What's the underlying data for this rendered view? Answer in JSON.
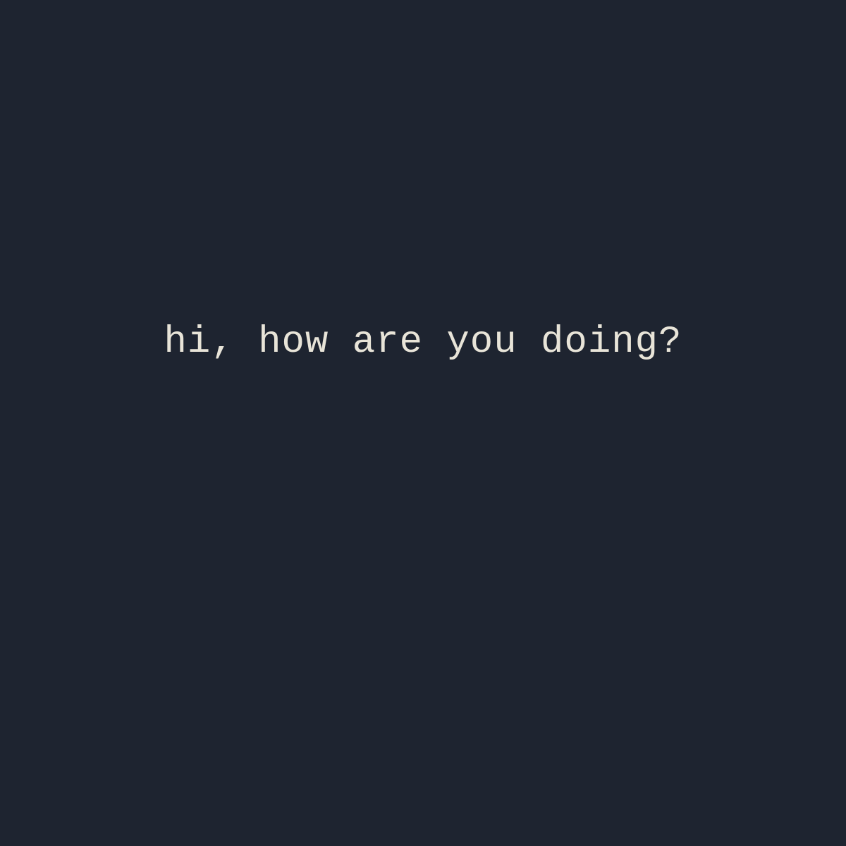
{
  "content": {
    "message": "hi, how are you doing?"
  },
  "colors": {
    "background": "#1e2430",
    "text": "#e8e4d8"
  }
}
